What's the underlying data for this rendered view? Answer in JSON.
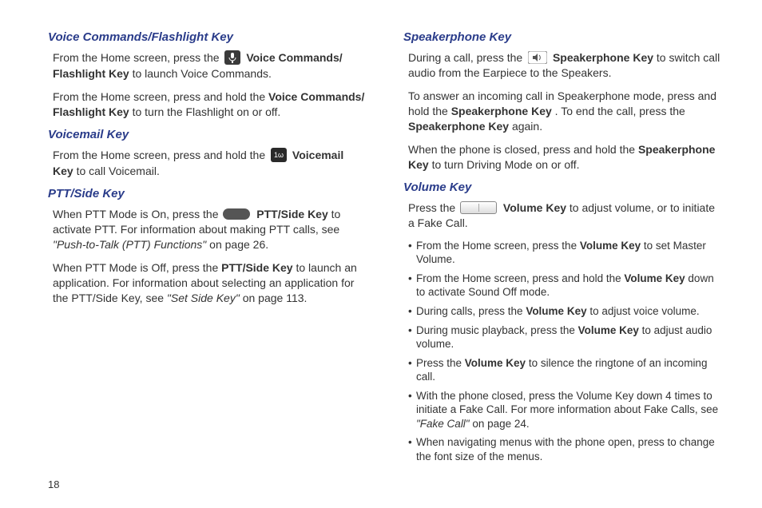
{
  "page_number": "18",
  "left": {
    "sec1": {
      "heading": "Voice Commands/Flashlight Key",
      "p1_a": "From the Home screen, press the ",
      "p1_icon_alt": "microphone-icon",
      "p1_b_bold": "Voice Commands/ Flashlight Key",
      "p1_c": " to launch Voice Commands.",
      "p2_a": "From the Home screen, press and hold the ",
      "p2_bold": "Voice Commands/ Flashlight Key",
      "p2_c": " to turn the Flashlight on or off."
    },
    "sec2": {
      "heading": "Voicemail Key",
      "p1_a": "From the Home screen, press and hold the ",
      "p1_icon_alt": "voicemail-icon",
      "p1_bold": "Voicemail Key",
      "p1_c": " to call Voicemail."
    },
    "sec3": {
      "heading": "PTT/Side Key",
      "p1_a": "When PTT Mode is On, press the ",
      "p1_icon_alt": "side-key-icon",
      "p1_bold": "PTT/Side Key",
      "p1_c": " to activate PTT. For information about making PTT calls, see ",
      "p1_quote": "\"Push-to-Talk (PTT) Functions\"",
      "p1_d": " on page 26.",
      "p2_a": "When PTT Mode is Off, press the ",
      "p2_bold": "PTT/Side Key",
      "p2_b": " to launch an application. For information about selecting an application for the PTT/Side Key, see ",
      "p2_quote": "\"Set Side Key\"",
      "p2_c": " on page 113."
    }
  },
  "right": {
    "sec1": {
      "heading": "Speakerphone Key",
      "p1_a": "During a call, press the ",
      "p1_icon_alt": "speaker-icon",
      "p1_bold": "Speakerphone Key",
      "p1_c": " to switch call audio from the Earpiece to the Speakers.",
      "p2_a": "To answer an incoming call in Speakerphone mode, press and hold the ",
      "p2_bold1": "Speakerphone Key",
      "p2_b": ". To end the call, press the ",
      "p2_bold2": "Speakerphone Key",
      "p2_c": " again.",
      "p3_a": "When the phone is closed, press and hold the ",
      "p3_bold": "Speakerphone Key",
      "p3_c": " to turn Driving Mode on or off."
    },
    "sec2": {
      "heading": "Volume Key",
      "p1_a": "Press the ",
      "p1_icon_alt": "volume-key-icon",
      "p1_bold": "Volume Key",
      "p1_c": " to adjust volume, or to initiate a Fake Call.",
      "bullets": [
        {
          "a": "From the Home screen, press the ",
          "bold": "Volume Key",
          "b": " to set Master Volume."
        },
        {
          "a": "From the Home screen, press and hold the ",
          "bold": "Volume Key",
          "b": " down to activate Sound Off mode."
        },
        {
          "a": "During calls, press the ",
          "bold": "Volume Key",
          "b": " to adjust voice volume."
        },
        {
          "a": "During music playback, press the ",
          "bold": "Volume Key",
          "b": " to adjust audio volume."
        },
        {
          "a": "Press the ",
          "bold": "Volume Key",
          "b": " to silence the ringtone of an incoming call."
        },
        {
          "a": "With the phone closed, press the Volume Key down 4 times to initiate a Fake Call. For more information about Fake Calls, see ",
          "quote": "\"Fake Call\"",
          "b": " on page 24."
        },
        {
          "a": "When navigating menus with the phone open, press to change the font size of the menus."
        }
      ]
    }
  }
}
